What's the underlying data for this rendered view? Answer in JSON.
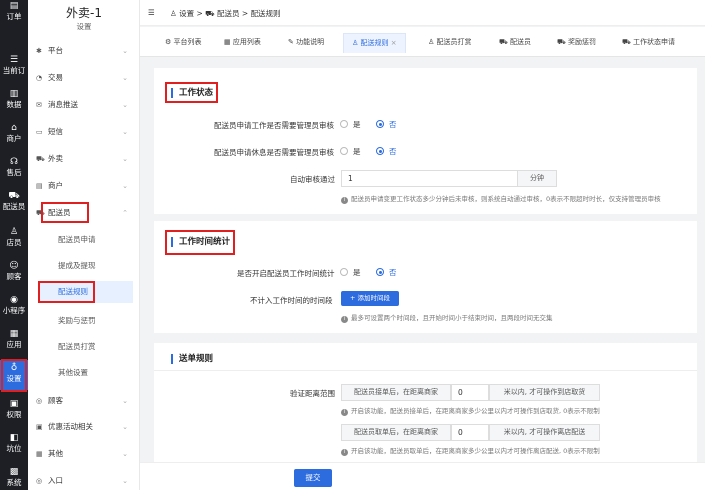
{
  "rail": [
    {
      "label": "订单",
      "glyph": "▤"
    },
    {
      "label": "当前订",
      "glyph": "☰"
    },
    {
      "label": "数据",
      "glyph": "▥"
    },
    {
      "label": "商户",
      "glyph": "⌂"
    },
    {
      "label": "售后",
      "glyph": "☊"
    },
    {
      "label": "配送员",
      "glyph": "⛟"
    },
    {
      "label": "店员",
      "glyph": "♙"
    },
    {
      "label": "顾客",
      "glyph": "☺"
    },
    {
      "label": "小程序",
      "glyph": "◉"
    },
    {
      "label": "应用",
      "glyph": "▦"
    },
    {
      "label": "设置",
      "glyph": "♁"
    },
    {
      "label": "权限",
      "glyph": "▣"
    },
    {
      "label": "坑位",
      "glyph": "◧"
    },
    {
      "label": "系统",
      "glyph": "▩"
    }
  ],
  "app": {
    "title": "外卖-1",
    "subtitle": "设置"
  },
  "sidebar": {
    "items": [
      {
        "label": "平台",
        "glyph": "✱"
      },
      {
        "label": "交易",
        "glyph": "◔"
      },
      {
        "label": "消息推送",
        "glyph": "✉"
      },
      {
        "label": "短信",
        "glyph": "▭"
      },
      {
        "label": "外卖",
        "glyph": "⛟"
      },
      {
        "label": "商户",
        "glyph": "▤"
      },
      {
        "label": "配送员",
        "glyph": "⛟"
      },
      {
        "label": "顾客",
        "glyph": "◎"
      },
      {
        "label": "优惠活动相关",
        "glyph": "▣"
      },
      {
        "label": "其他",
        "glyph": "▦"
      },
      {
        "label": "入口",
        "glyph": "◎"
      }
    ],
    "sub": [
      "配送员申请",
      "提成及提现",
      "配送规则",
      "奖励与惩罚",
      "配送员打赏",
      "其他设置"
    ]
  },
  "breadcrumb": {
    "toggle": "☰",
    "s1": "设置",
    "s2": "配送员",
    "s3": "配送规则"
  },
  "tabs": [
    {
      "label": "平台列表",
      "glyph": "⚙"
    },
    {
      "label": "应用列表",
      "glyph": "▦"
    },
    {
      "label": "功能说明",
      "glyph": "✎"
    },
    {
      "label": "配送规则",
      "glyph": "♙",
      "close": "×"
    },
    {
      "label": "配送员打赏",
      "glyph": "♙"
    },
    {
      "label": "配送员",
      "glyph": "⛟"
    },
    {
      "label": "奖励惩罚",
      "glyph": "⛟"
    },
    {
      "label": "工作状态申请",
      "glyph": "⛟"
    }
  ],
  "work_status": {
    "title": "工作状态",
    "q1": "配送员申请工作是否需要管理员审核",
    "q2": "配送员申请休息是否需要管理员审核",
    "yes": "是",
    "no": "否",
    "auto_label": "自动审核通过",
    "auto_value": "1",
    "auto_unit": "分钟",
    "auto_note": "配送员申请变更工作状态多少分钟后未审核，则系统自动通过审核，0表示不限超时时长，仅支持管理员审核"
  },
  "work_time": {
    "title": "工作时间统计",
    "q": "是否开启配送员工作时间统计",
    "yes": "是",
    "no": "否",
    "excl_label": "不计入工作时间的时间段",
    "add_btn": "+ 添加时间段",
    "note": "最多可设置两个时间段，且开始时间小于结束时间，且两段时间无交集"
  },
  "dispatch": {
    "title": "送单规则",
    "dist_label": "验证距离范围",
    "row1_prefix": "配送员接单后，在距离商家",
    "row1_value": "0",
    "row1_suffix": "米以内, 才可操作到店取货",
    "row1_note": "开启该功能，配送员接单后，在距离商家多少公里以内才可操作到店取货, 0表示不限制",
    "row2_prefix": "配送员取单后，在距离商家",
    "row2_value": "0",
    "row2_suffix": "米以内, 才可操作离店配送",
    "row2_note": "开启该功能，配送员取单后，在距离商家多少公里以内才可操作离店配送, 0表示不限制"
  },
  "submit": "提交"
}
